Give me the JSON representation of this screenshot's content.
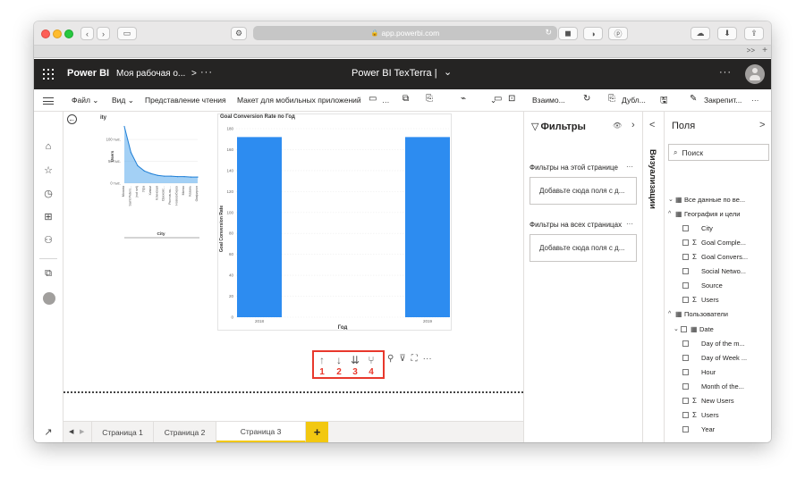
{
  "browser": {
    "url": "app.powerbi.com",
    "lock_icon": "🔒",
    "tab_chevrons": ">>",
    "tab_plus": "+"
  },
  "header": {
    "brand": "Power BI",
    "workspace": "Моя рабочая о...",
    "workspace_chevron": ">",
    "dots": "···",
    "report_title": "Power BI TexTerra  |",
    "caret": "⌄",
    "more": "···"
  },
  "ribbon": {
    "file": "Файл ⌄",
    "view": "Вид ⌄",
    "reading": "Представление чтения",
    "mobile": "Макет для мобильных приложений",
    "interact": "Взаимо...",
    "duplicate": "Дубл...",
    "pin": "Закрепит...",
    "more": "···"
  },
  "canvas": {
    "chart1": {
      "title": "ity",
      "ylabel": "Users",
      "xlabel": "City",
      "yticks": [
        "100 тыс.",
        "50 тыс.",
        "0 тыс."
      ],
      "categories": [
        "Москва",
        "Saint Peters...",
        "(not set)",
        "Уфа",
        "Химки",
        "Клинская",
        "Ореховс...",
        "Ростов-на-...",
        "Новосибирск",
        "Минск",
        "Казань",
        "Омфиргоп"
      ]
    },
    "chart2": {
      "title": "Goal Conversion Rate по Год",
      "ylabel": "Goal Conversion Rate",
      "xlabel": "Год",
      "yticks": [
        "180",
        "160",
        "140",
        "120",
        "100",
        "80",
        "60",
        "40",
        "20",
        "0"
      ],
      "xticks": [
        "2018",
        "2019"
      ]
    },
    "drill_numbers": [
      "1",
      "2",
      "3",
      "4"
    ]
  },
  "chart_data": [
    {
      "type": "area",
      "title": "ity",
      "xlabel": "City",
      "ylabel": "Users",
      "categories": [
        "Москва",
        "Saint Peters...",
        "(not set)",
        "Уфа",
        "Химки",
        "Клинская",
        "Ореховс...",
        "Ростов-на-...",
        "Новосибирск",
        "Минск",
        "Казань",
        "Омфиргоп"
      ],
      "values": [
        130,
        70,
        40,
        28,
        22,
        18,
        16,
        16,
        15,
        15,
        14,
        14
      ],
      "ylim": [
        0,
        135
      ],
      "y_unit": "тыс."
    },
    {
      "type": "bar",
      "title": "Goal Conversion Rate по Год",
      "xlabel": "Год",
      "ylabel": "Goal Conversion Rate",
      "categories": [
        "2018",
        "2019"
      ],
      "values": [
        172,
        172
      ],
      "ylim": [
        0,
        180
      ],
      "color": "#2d8cf0"
    }
  ],
  "pages": {
    "tabs": [
      "Страница 1",
      "Страница 2",
      "Страница 3"
    ],
    "active_index": 2,
    "add": "+",
    "prev": "◀",
    "next": "▶"
  },
  "filters": {
    "title": "Фильтры",
    "on_page_label": "Фильтры на этой странице",
    "on_page_box": "Добавьте сюда поля с д...",
    "all_pages_label": "Фильтры на всех страницах",
    "all_pages_box": "Добавьте сюда поля с д...",
    "dots": "···"
  },
  "visualizations": {
    "label": "Визуализации",
    "chevron": "<"
  },
  "fields_pane": {
    "title": "Поля",
    "chevron": ">",
    "search_placeholder": "Поиск",
    "items": [
      {
        "kind": "table",
        "label": "Все данные по ве..."
      },
      {
        "kind": "table",
        "label": "География и цели"
      },
      {
        "kind": "field",
        "label": "City",
        "sigma": false
      },
      {
        "kind": "field",
        "label": "Goal Comple...",
        "sigma": true
      },
      {
        "kind": "field",
        "label": "Goal Convers...",
        "sigma": true
      },
      {
        "kind": "field",
        "label": "Social Netwo...",
        "sigma": false
      },
      {
        "kind": "field",
        "label": "Source",
        "sigma": false
      },
      {
        "kind": "field",
        "label": "Users",
        "sigma": true
      },
      {
        "kind": "table",
        "label": "Пользователи"
      },
      {
        "kind": "date",
        "label": "Date"
      },
      {
        "kind": "field",
        "label": "Day of the m...",
        "sigma": false
      },
      {
        "kind": "field",
        "label": "Day of Week ...",
        "sigma": false
      },
      {
        "kind": "field",
        "label": "Hour",
        "sigma": false
      },
      {
        "kind": "field",
        "label": "Month of the...",
        "sigma": false
      },
      {
        "kind": "field",
        "label": "New Users",
        "sigma": true
      },
      {
        "kind": "field",
        "label": "Users",
        "sigma": true
      },
      {
        "kind": "field",
        "label": "Year",
        "sigma": false
      }
    ]
  },
  "colors": {
    "header_bg": "#252423",
    "accent_yellow": "#f2c811",
    "bar_blue": "#2d8cf0",
    "area_blue": "#58a9ec",
    "highlight_red": "#e8382c"
  }
}
